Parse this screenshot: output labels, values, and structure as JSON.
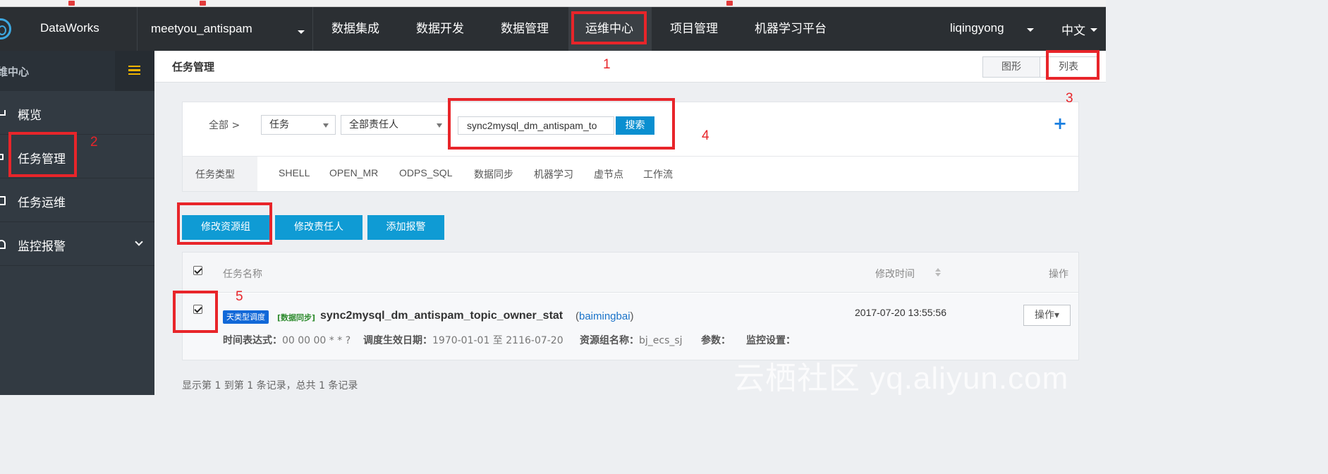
{
  "brand": {
    "name": "DataWorks"
  },
  "project": {
    "name": "meetyou_antispam"
  },
  "nav": [
    {
      "label": "数据集成"
    },
    {
      "label": "数据开发"
    },
    {
      "label": "数据管理"
    },
    {
      "label": "运维中心"
    },
    {
      "label": "项目管理"
    },
    {
      "label": "机器学习平台"
    }
  ],
  "user": {
    "name": "liqingyong",
    "language": "中文"
  },
  "sidebar": {
    "title": "维中心",
    "items": [
      {
        "label": "概览",
        "icon": "chart-icon"
      },
      {
        "label": "任务管理",
        "icon": "hierarchy-icon"
      },
      {
        "label": "任务运维",
        "icon": "calendar-icon"
      },
      {
        "label": "监控报警",
        "icon": "bell-icon"
      }
    ]
  },
  "page": {
    "title": "任务管理",
    "views": {
      "graph": "图形",
      "list": "列表"
    }
  },
  "filter": {
    "all": "全部 >",
    "task_select": "任务",
    "owner_select": "全部责任人",
    "search_value": "sync2mysql_dm_antispam_to",
    "search_button": "搜索",
    "add": "+",
    "type_label": "任务类型",
    "types": [
      "SHELL",
      "OPEN_MR",
      "ODPS_SQL",
      "数据同步",
      "机器学习",
      "虚节点",
      "工作流"
    ]
  },
  "actions": {
    "modify_resource_group": "修改资源组",
    "modify_owner": "修改责任人",
    "add_alarm": "添加报警"
  },
  "table": {
    "headers": {
      "name": "任务名称",
      "modified": "修改时间",
      "ops": "操作"
    },
    "row": {
      "schedule_badge": "天类型调度",
      "type_badge": "[数据同步]",
      "name": "sync2mysql_dm_antispam_topic_owner_stat",
      "owner_open": "(",
      "owner": "baimingbai",
      "owner_close": ")",
      "time": "2017-07-20 13:55:56",
      "op_button": "操作▾",
      "cron_label": "时间表达式：",
      "cron": "00 00 00 * * ?",
      "effective_label": "调度生效日期：",
      "effective": "1970-01-01  至  2116-07-20",
      "resource_label": "资源组名称：",
      "resource": "bj_ecs_sj",
      "params_label": "参数：",
      "monitor_label": "监控设置："
    }
  },
  "footer": {
    "info": "显示第 1 到第 1 条记录，总共 1 条记录"
  },
  "annotations": [
    "1",
    "2",
    "3",
    "4",
    "5"
  ],
  "watermark": "云栖社区 yq.aliyun.com",
  "colors": {
    "accent": "#0f9bd4",
    "annotation": "#e8252a",
    "topbar": "#2b2f33",
    "sidebar": "#323a42"
  }
}
